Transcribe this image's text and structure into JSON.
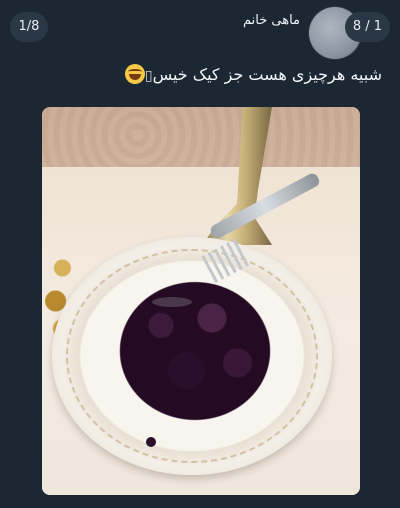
{
  "viewer": {
    "page_counter_left": "1/8",
    "page_counter_right": "8 / 1"
  },
  "post": {
    "username": "ماهی خانم",
    "text": "شبیه هرچیزی هست جز کیک خیس",
    "emoji_icon": "laughing-tears-emoji"
  },
  "colors": {
    "background": "#1b2733",
    "badge": "#2a3846"
  }
}
